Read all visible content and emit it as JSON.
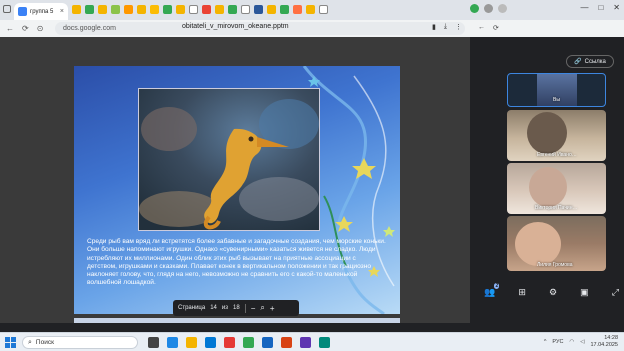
{
  "browser": {
    "tab_title": "группа 5",
    "url": "docs.google.com",
    "doc_title": "obitateli_v_mirovom_okeane.pptm"
  },
  "slide": {
    "text": "Среди рыб вам вряд ли встретятся более забавные и загадочные создания, чем морские коньки. Они больше напоминают игрушки. Однако «сувенирными» казаться живется не сладко. Люди истребляют их миллионами. Один облик этих рыб вызывает на приятные ассоциации с детством, игрушками и сказками. Плавает конек в вертикальном положении и так грациозно наклоняет голову, что, глядя на него, невозможно не сравнить его с какой-то маленькой волшебной лошадкой."
  },
  "pager": {
    "label": "Страница",
    "current": "14",
    "of": "из",
    "total": "18",
    "minus": "−",
    "plus": "+"
  },
  "call": {
    "link_label": "Ссылка",
    "participants": [
      {
        "name": "Вы"
      },
      {
        "name": "Евгений Ивано…"
      },
      {
        "name": "Виктория Пачин…"
      },
      {
        "name": "Лилия Громова"
      }
    ],
    "people_count": "2"
  },
  "taskbar": {
    "search_label": "Поиск",
    "lang": "РУС",
    "time": "14:28",
    "date": "17.04.2025"
  },
  "colors": {
    "accent": "#1a73e8",
    "dark_bg": "#202124"
  }
}
